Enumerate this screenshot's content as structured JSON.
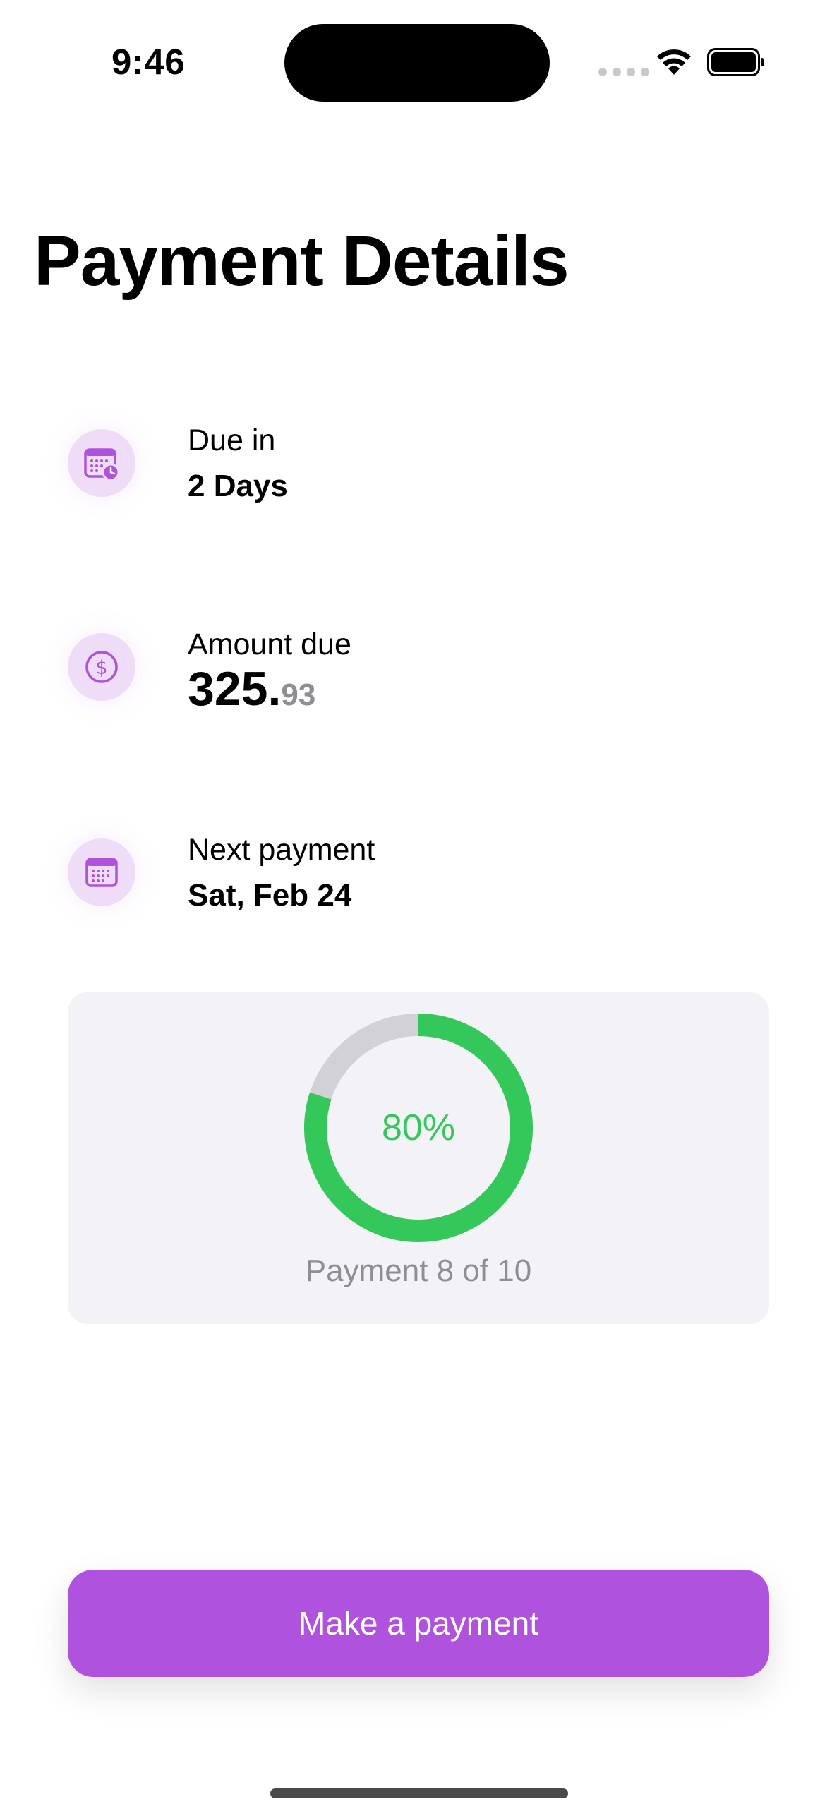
{
  "status_bar": {
    "time": "9:46"
  },
  "title": "Payment Details",
  "due": {
    "label": "Due in",
    "value": "2 Days",
    "icon": "calendar-clock-icon"
  },
  "amount": {
    "label": "Amount due",
    "whole": "325.",
    "cents": "93",
    "icon": "dollar-circle-icon"
  },
  "next_payment": {
    "label": "Next payment",
    "value": "Sat, Feb 24",
    "icon": "calendar-icon"
  },
  "progress": {
    "percent_label": "80%",
    "fraction": 0.8,
    "caption": "Payment 8 of 10"
  },
  "button": {
    "label": "Make a payment"
  },
  "colors": {
    "accent": "#af52de",
    "icon_bg": "#efdcf6",
    "progress": "#34c759",
    "track": "#d1d1d6",
    "card": "#f2f2f7"
  }
}
